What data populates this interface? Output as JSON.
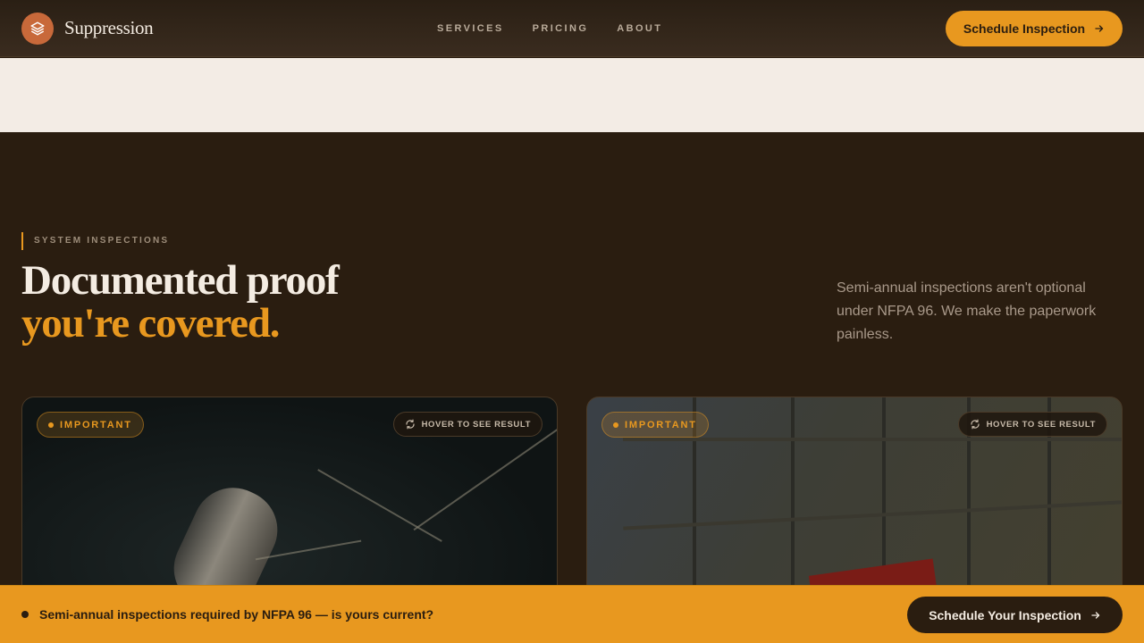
{
  "header": {
    "brand": "Suppression",
    "logo_icon": "layers-icon",
    "nav": [
      "SERVICES",
      "PRICING",
      "ABOUT"
    ],
    "cta_label": "Schedule Inspection",
    "cta_icon": "arrow-right-icon"
  },
  "section": {
    "eyebrow": "SYSTEM INSPECTIONS",
    "headline_line1": "Documented proof",
    "headline_line2": "you're covered.",
    "intro": "Semi-annual inspections aren't optional under NFPA 96. We make the paperwork painless."
  },
  "cards": [
    {
      "badge": "IMPORTANT",
      "hover_label": "HOVER TO SEE RESULT"
    },
    {
      "badge": "IMPORTANT",
      "hover_label": "HOVER TO SEE RESULT"
    }
  ],
  "bottom_bar": {
    "message": "Semi-annual inspections required by NFPA 96 — is yours current?",
    "cta_label": "Schedule Your Inspection"
  },
  "colors": {
    "accent": "#e8981f",
    "dark_bg": "#2a1d10",
    "light_band": "#f3ece5",
    "logo": "#c8693a"
  }
}
